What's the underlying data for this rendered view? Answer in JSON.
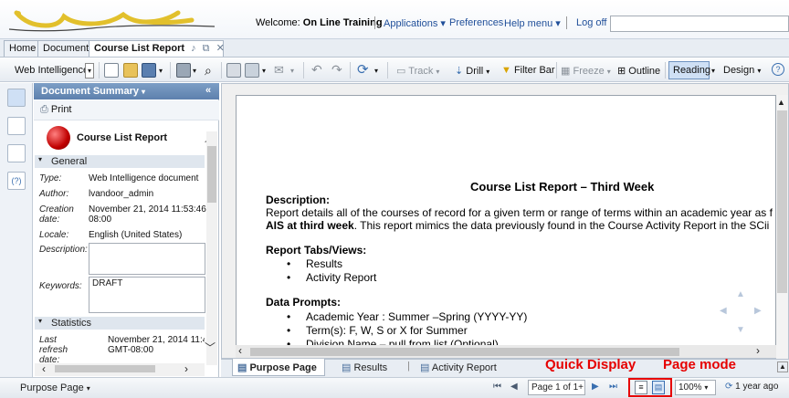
{
  "header": {
    "welcome_prefix": "Welcome:",
    "user_name": "On Line Training",
    "links": [
      "Applications",
      "Preferences",
      "Help menu",
      "Log off"
    ]
  },
  "tabs": [
    "Home",
    "Documents",
    "Course List Report"
  ],
  "toolbar": {
    "mode_label": "Web Intelligence",
    "track": "Track",
    "drill": "Drill",
    "filter_bar": "Filter Bar",
    "freeze": "Freeze",
    "outline": "Outline",
    "reading": "Reading",
    "design": "Design"
  },
  "panel": {
    "title": "Document Summary",
    "print": "Print",
    "doc_title": "Course List Report",
    "general": "General",
    "type_label": "Type:",
    "type_value": "Web Intelligence document",
    "author_label": "Author:",
    "author_value": "lvandoor_admin",
    "creation_label": "Creation date:",
    "creation_value1": "November 21, 2014 11:53:46",
    "creation_value2": "08:00",
    "locale_label": "Locale:",
    "locale_value": "English (United States)",
    "description_label": "Description:",
    "keywords_label": "Keywords:",
    "keywords_value": "DRAFT",
    "statistics": "Statistics",
    "refresh_label": "Last refresh date:",
    "refresh_value1": "November 21, 2014 11:4",
    "refresh_value2": "GMT-08:00"
  },
  "report": {
    "title": "Course List Report – Third Week",
    "description_h": "Description:",
    "desc_line1": "Report details all of the courses of record for a given term or range of terms within an academic year as f",
    "desc_line2_bold": "AIS at third week",
    "desc_line2_rest": ". This report mimics the data previously found in the Course Activity Report in the SCii",
    "tabs_h": "Report Tabs/Views:",
    "tab_items": [
      "Results",
      "Activity Report"
    ],
    "prompts_h": "Data Prompts:",
    "prompt_items": [
      "Academic Year : Summer –Spring (YYYY-YY)",
      "Term(s): F, W, S or X for Summer",
      "Division Name – pull from list (Optional)"
    ]
  },
  "report_tabs": [
    "Purpose Page",
    "Results",
    "Activity Report"
  ],
  "status": {
    "view": "Purpose Page",
    "page": "Page 1 of 1+",
    "zoom": "100%",
    "refresh": "1 year ago"
  },
  "annotations": {
    "quick_display": "Quick Display",
    "page_mode": "Page mode"
  }
}
